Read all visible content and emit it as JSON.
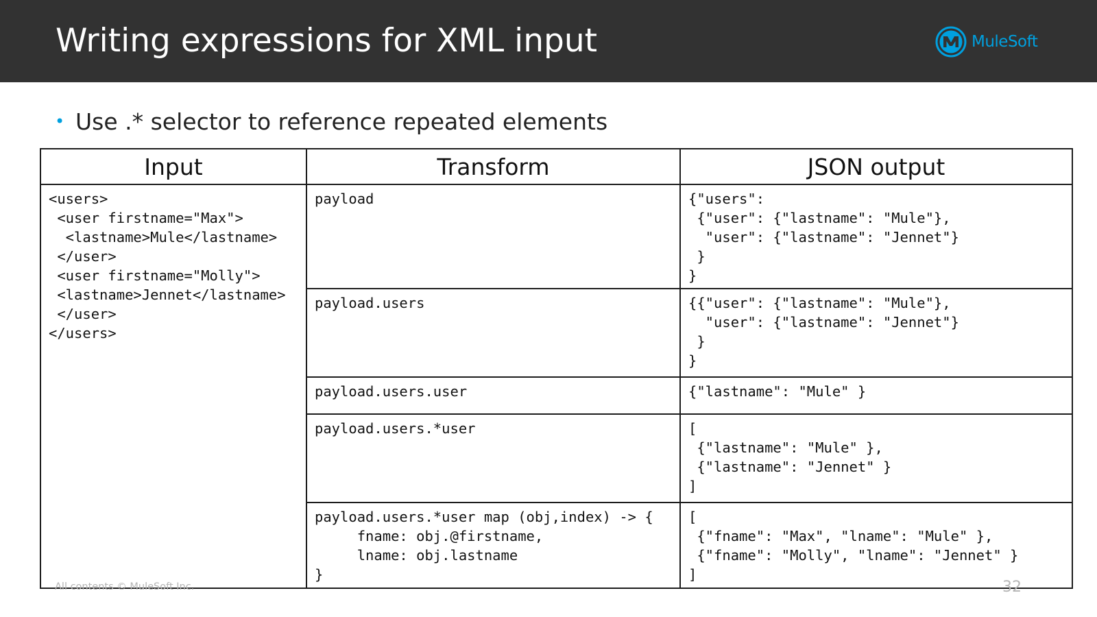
{
  "slide": {
    "title": "Writing expressions for XML input",
    "logo": {
      "text": "MuleSoft",
      "icon": "mulesoft-logo-icon",
      "color": "#00a0df"
    },
    "bullet": "Use .* selector to reference repeated elements",
    "header_bg": "#323232"
  },
  "table": {
    "headers": [
      "Input",
      "Transform",
      "JSON output"
    ],
    "input": "<users>\n <user firstname=\"Max\">\n  <lastname>Mule</lastname>\n </user>\n <user firstname=\"Molly\">\n <lastname>Jennet</lastname>\n </user>\n</users>",
    "rows": [
      {
        "transform": "payload",
        "output": "{\"users\":\n {\"user\": {\"lastname\": \"Mule\"},\n  \"user\": {\"lastname\": \"Jennet\"}\n }\n}"
      },
      {
        "transform": "payload.users",
        "output": "{{\"user\": {\"lastname\": \"Mule\"},\n  \"user\": {\"lastname\": \"Jennet\"}\n }\n}"
      },
      {
        "transform": "payload.users.user",
        "output": "{\"lastname\": \"Mule\" }"
      },
      {
        "transform": "payload.users.*user",
        "output": "[\n {\"lastname\": \"Mule\" },\n {\"lastname\": \"Jennet\" }\n]"
      },
      {
        "transform": "payload.users.*user map (obj,index) -> {\n     fname: obj.@firstname,\n     lname: obj.lastname\n}",
        "output": "[\n {\"fname\": \"Max\", \"lname\": \"Mule\" },\n {\"fname\": \"Molly\", \"lname\": \"Jennet\" }\n]"
      }
    ]
  },
  "footer": {
    "copyright": "All contents © MuleSoft Inc.",
    "page_number": "32"
  }
}
